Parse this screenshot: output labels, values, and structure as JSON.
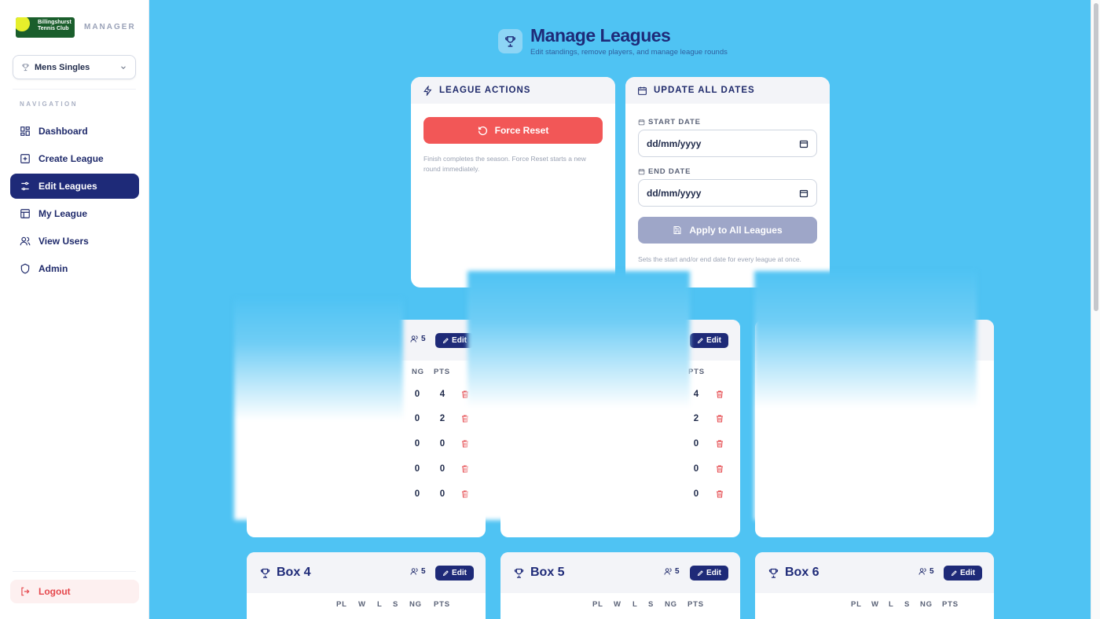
{
  "app": {
    "logo_text": "Billingshurst Tennis Club",
    "title": "MANAGER"
  },
  "league_selector": {
    "value": "Mens Singles"
  },
  "nav": {
    "label": "NAVIGATION",
    "items": [
      {
        "label": "Dashboard",
        "icon": "dashboard-icon"
      },
      {
        "label": "Create League",
        "icon": "plus-square-icon"
      },
      {
        "label": "Edit Leagues",
        "icon": "sliders-icon",
        "active": true
      },
      {
        "label": "My League",
        "icon": "table-icon"
      },
      {
        "label": "View Users",
        "icon": "users-icon"
      },
      {
        "label": "Admin",
        "icon": "shield-icon"
      }
    ],
    "logout": "Logout"
  },
  "header": {
    "title": "Manage Leagues",
    "subtitle": "Edit standings, remove players, and manage league rounds"
  },
  "league_actions": {
    "title": "LEAGUE ACTIONS",
    "force_reset": "Force Reset",
    "note": "Finish completes the season. Force Reset starts a new round immediately."
  },
  "update_dates": {
    "title": "UPDATE ALL DATES",
    "start_label": "START DATE",
    "start_value": "dd/mm/yyyy",
    "end_label": "END DATE",
    "end_value": "dd/mm/yyyy",
    "apply": "Apply to All Leagues",
    "note": "Sets the start and/or end date for every league at once."
  },
  "boxes_top": [
    {
      "players": "5",
      "edit": "Edit",
      "col_ng": "NG",
      "col_pts": "PTS",
      "ng": [
        "0",
        "0",
        "0",
        "0",
        "0"
      ],
      "pts": [
        "4",
        "2",
        "0",
        "0",
        "0"
      ]
    },
    {
      "edit": "Edit",
      "col_pts": "PTS",
      "pts": [
        "4",
        "2",
        "0",
        "0",
        "0"
      ]
    },
    {}
  ],
  "boxes_bottom": [
    {
      "title": "Box 4",
      "players": "5",
      "edit": "Edit"
    },
    {
      "title": "Box 5",
      "players": "5",
      "edit": "Edit"
    },
    {
      "title": "Box 6",
      "players": "5",
      "edit": "Edit"
    }
  ],
  "table_columns": [
    "PL",
    "W",
    "L",
    "S",
    "NG",
    "PTS"
  ],
  "colors": {
    "accent": "#1e2a78",
    "background": "#4fc3f3",
    "danger": "#f25757",
    "disabled": "#9ea6c8"
  }
}
